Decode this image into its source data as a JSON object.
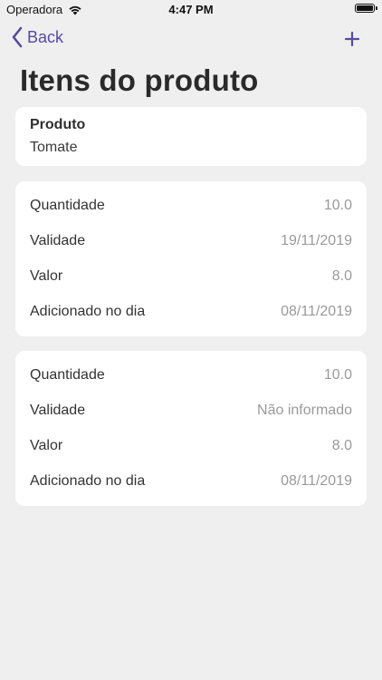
{
  "status_bar": {
    "carrier": "Operadora",
    "time": "4:47 PM"
  },
  "nav": {
    "back_label": "Back",
    "add_icon": "plus-icon",
    "accent_color": "#574b9e"
  },
  "page": {
    "title": "Itens do produto"
  },
  "product": {
    "label": "Produto",
    "value": "Tomate"
  },
  "items": [
    {
      "rows": [
        {
          "label": "Quantidade",
          "value": "10.0"
        },
        {
          "label": "Validade",
          "value": "19/11/2019"
        },
        {
          "label": "Valor",
          "value": "8.0"
        },
        {
          "label": "Adicionado no dia",
          "value": "08/11/2019"
        }
      ]
    },
    {
      "rows": [
        {
          "label": "Quantidade",
          "value": "10.0"
        },
        {
          "label": "Validade",
          "value": "Não informado"
        },
        {
          "label": "Valor",
          "value": "8.0"
        },
        {
          "label": "Adicionado no dia",
          "value": "08/11/2019"
        }
      ]
    }
  ]
}
